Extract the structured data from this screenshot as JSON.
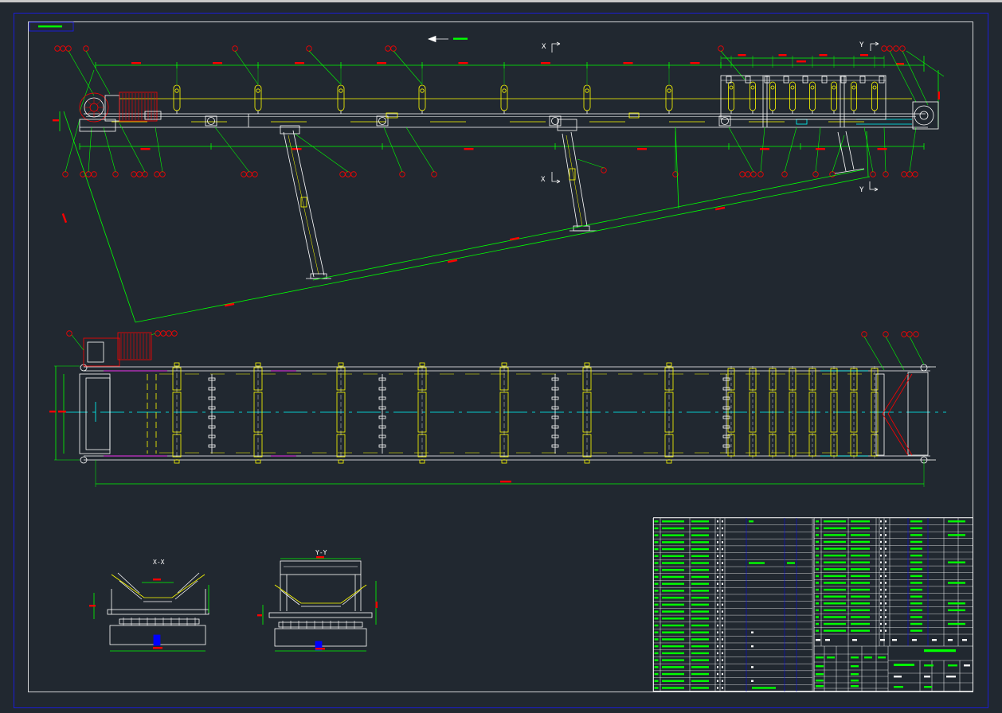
{
  "drawing": {
    "section_x_title": "X-X",
    "section_y_title": "Y-Y",
    "section_mark_x_top": "X",
    "section_mark_x_bottom": "X",
    "section_mark_y_top": "Y",
    "section_mark_y_bottom": "Y"
  },
  "colors": {
    "background": "#212830",
    "window_edge": "#c9c9c9",
    "border": "#1a1aff",
    "outline": "#ffffff",
    "idler": "#ffff00",
    "dimension": "#00ff00",
    "annotation": "#ff0000",
    "centerline": "#00ffff",
    "highlight": "#ff00ff",
    "accent": "#0000ff"
  }
}
